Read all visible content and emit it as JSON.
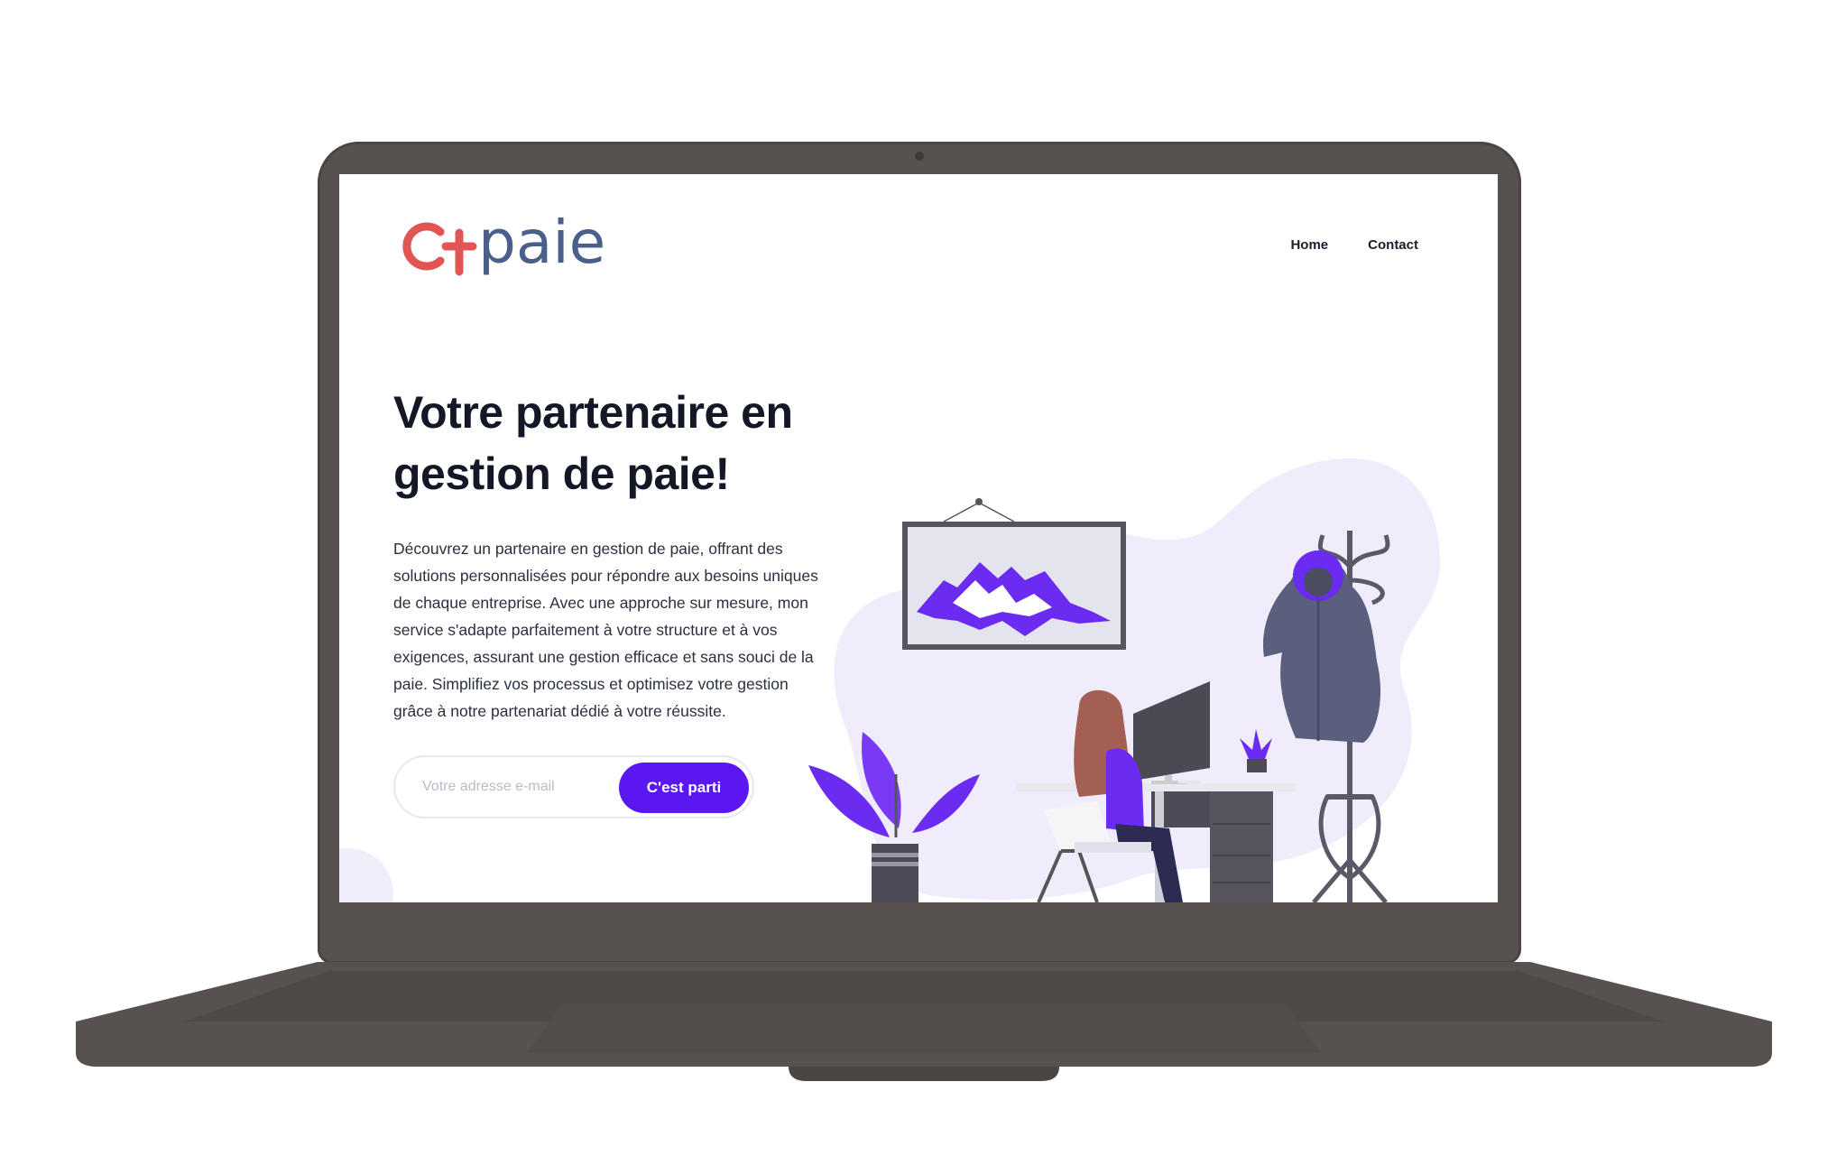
{
  "brand": {
    "logo_text": "paie",
    "logo_colors": {
      "symbol": "#e25555",
      "text": "#4a5f8a"
    }
  },
  "nav": {
    "items": [
      {
        "label": "Home"
      },
      {
        "label": "Contact"
      }
    ]
  },
  "hero": {
    "title": "Votre partenaire en gestion de paie!",
    "description": "Découvrez un partenaire en gestion de paie, offrant des solutions personnalisées pour répondre aux besoins uniques de chaque entreprise. Avec une approche sur mesure, mon service s'adapte parfaitement à votre structure et à vos exigences, assurant une gestion efficace et sans souci de la paie. Simplifiez vos processus et optimisez votre gestion grâce à notre partenariat dédié à votre réussite.",
    "email_placeholder": "Votre adresse e-mail",
    "email_value": "",
    "cta_label": "C'est parti"
  },
  "theme": {
    "accent": "#5b17f2",
    "illustration_purple": "#6c2bf0",
    "blob": "#f0ecfb",
    "laptop_frame": "#57524f"
  }
}
